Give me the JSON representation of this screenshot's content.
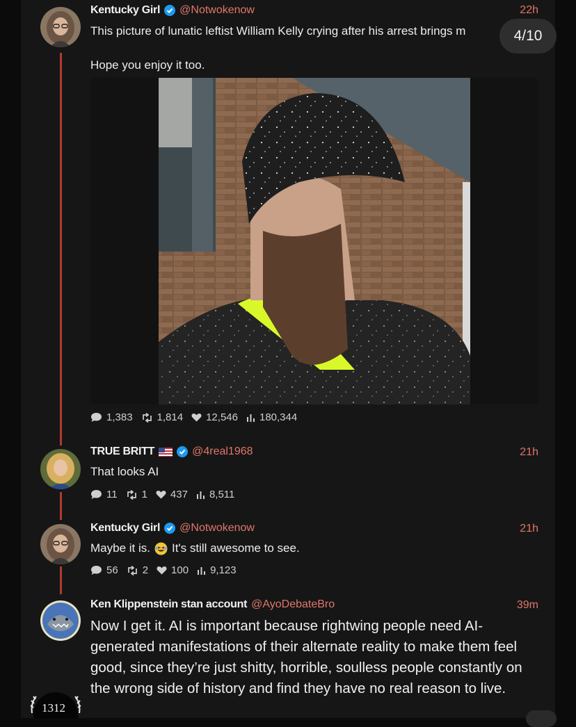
{
  "pager": {
    "label": "4/10"
  },
  "tweets": [
    {
      "name": "Kentucky Girl",
      "handle": "@Notwokenow",
      "time": "22h",
      "lines": [
        "This picture of lunatic leftist William Kelly crying after his arrest brings m",
        "Hope you enjoy it too."
      ],
      "stats": {
        "replies": "1,383",
        "reposts": "1,814",
        "likes": "12,546",
        "views": "180,344"
      }
    },
    {
      "name": "TRUE BRITT",
      "handle": "@4real1968",
      "time": "21h",
      "lines": [
        "That looks AI"
      ],
      "stats": {
        "replies": "11",
        "reposts": "1",
        "likes": "437",
        "views": "8,511"
      }
    },
    {
      "name": "Kentucky Girl",
      "handle": "@Notwokenow",
      "time": "21h",
      "lines": [
        "Maybe it is.",
        "It's still awesome to see."
      ],
      "stats": {
        "replies": "56",
        "reposts": "2",
        "likes": "100",
        "views": "9,123"
      }
    },
    {
      "name": "Ken Klippenstein stan account",
      "handle": "@AyoDebateBro",
      "time": "39m",
      "lines": [
        "Now I get it. AI is important because rightwing people need AI-generated manifestations of their alternate reality to make them feel good, since they’re just shitty, horrible, soulless people constantly on the wrong side of history and find they have no real reason to live."
      ]
    }
  ],
  "badge": {
    "label": "1312"
  },
  "colors": {
    "accent": "#e0776a",
    "thread": "#b23a30",
    "verified": "#1d9bf0",
    "neon": "#d9f82a"
  },
  "icons": {
    "reply": "speech-bubble-icon",
    "repost": "repost-arrows-icon",
    "like": "heart-icon",
    "views": "bar-chart-icon",
    "verified": "verified-check-icon",
    "flag": "us-flag-icon",
    "emoji": "laughing-emoji-icon"
  }
}
